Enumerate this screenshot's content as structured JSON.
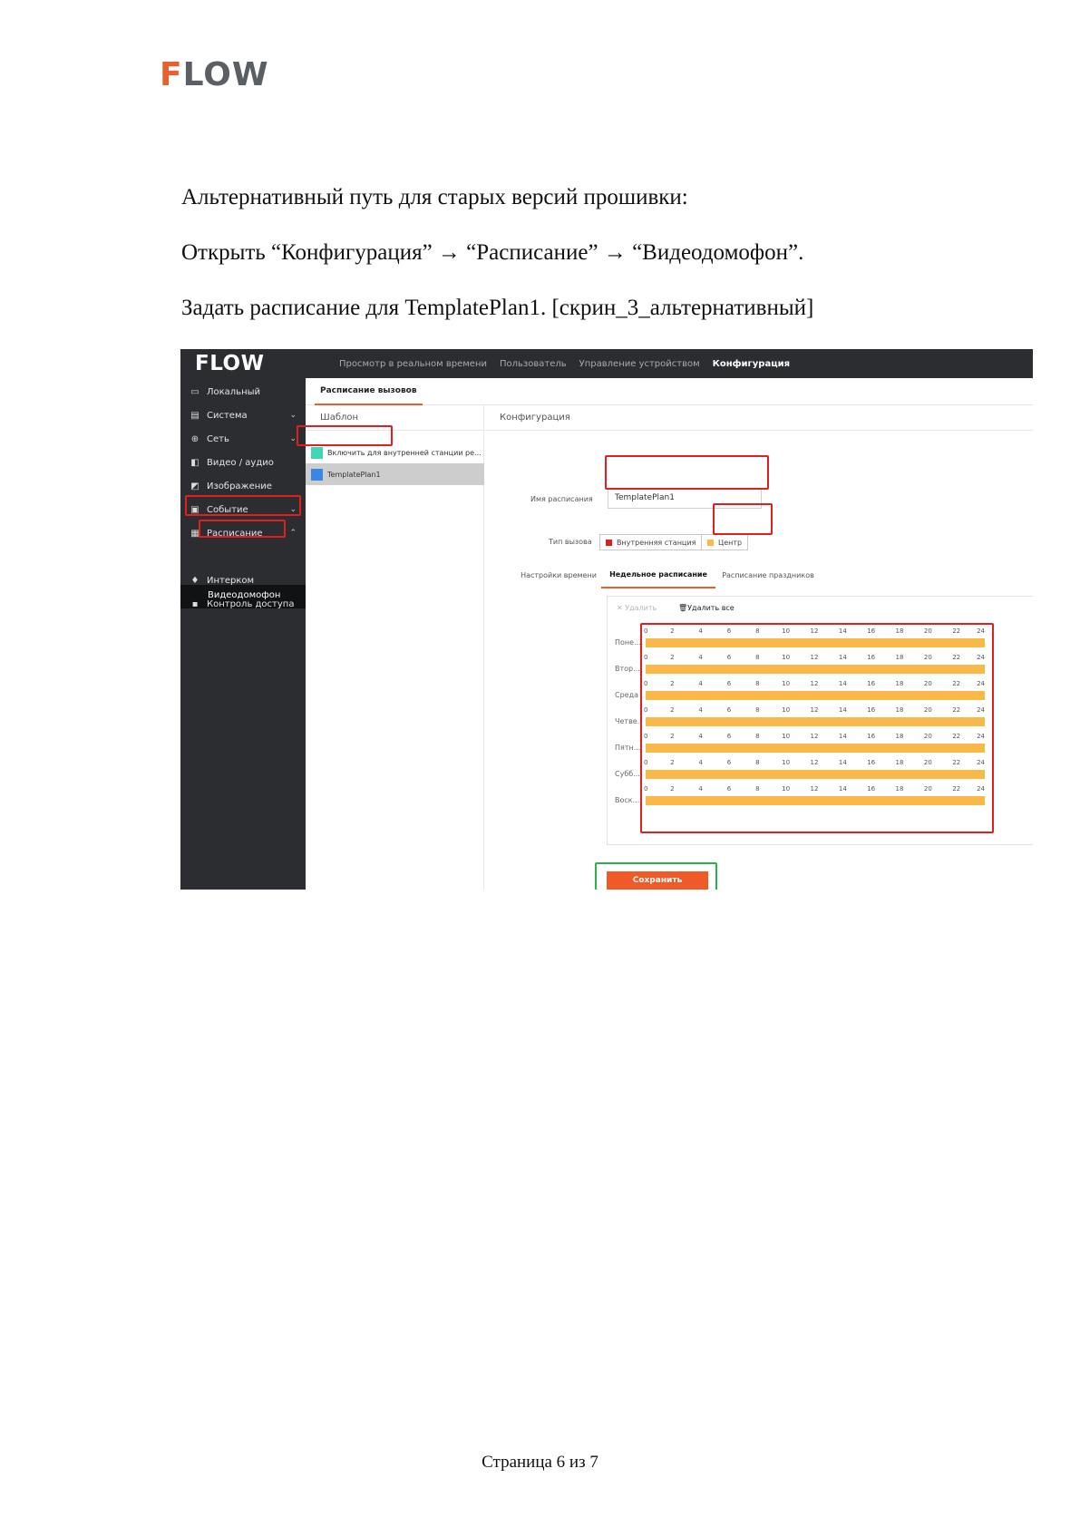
{
  "document": {
    "logo": "FLOW",
    "lines": [
      "Альтернативный путь для старых версий прошивки:",
      "Открыть “Конфигурация” → “Расписание” → “Видеодомофон”.",
      "Задать расписание для TemplatePlan1. [скрин_3_альтернативный]"
    ],
    "footer": "Страница 6 из 7"
  },
  "screenshot": {
    "logo": "FLOW",
    "topnav": [
      "Просмотр в реальном времени",
      "Пользователь",
      "Управление устройством",
      "Конфигурация"
    ],
    "topnav_active": 3,
    "sidebar": [
      {
        "label": "Локальный",
        "icon": "monitor-icon",
        "chevron": ""
      },
      {
        "label": "Система",
        "icon": "system-icon",
        "chevron": "down"
      },
      {
        "label": "Сеть",
        "icon": "globe-icon",
        "chevron": "down"
      },
      {
        "label": "Видео / аудио",
        "icon": "camera-icon",
        "chevron": ""
      },
      {
        "label": "Изображение",
        "icon": "image-icon",
        "chevron": ""
      },
      {
        "label": "Событие",
        "icon": "clipboard-icon",
        "chevron": "down"
      },
      {
        "label": "Расписание",
        "icon": "schedule-icon",
        "chevron": "up"
      },
      {
        "label": "Интерком",
        "icon": "microphone-icon",
        "chevron": ""
      },
      {
        "label": "Контроль доступа",
        "icon": "lock-icon",
        "chevron": ""
      }
    ],
    "sidebar_sub": "Видеодомофон",
    "subtab": "Расписание вызовов",
    "template_header": "Шаблон",
    "templates": [
      {
        "label": "Включить для внутренней станции ре...",
        "color": "#41d6b4",
        "selected": false
      },
      {
        "label": "TemplatePlan1",
        "color": "#3a86e0",
        "selected": true
      }
    ],
    "config_header": "Конфигурация",
    "schedule_name_label": "Имя расписания",
    "schedule_name_value": "TemplatePlan1",
    "call_type_label": "Тип вызова",
    "call_types": [
      {
        "label": "Внутренняя станция",
        "color": "#e02020"
      },
      {
        "label": "Центр",
        "color": "#f9b848"
      }
    ],
    "schedule_tabs": [
      "Настройки времени",
      "Недельное расписание",
      "Расписание праздников"
    ],
    "schedule_tab_active": 1,
    "delete_label": "Удалить",
    "delete_all_label": "Удалить все",
    "days": [
      "Поне...",
      "Втор...",
      "Среда",
      "Четве...",
      "Пятн...",
      "Субб...",
      "Воск..."
    ],
    "hours": [
      "0",
      "2",
      "4",
      "6",
      "8",
      "10",
      "12",
      "14",
      "16",
      "18",
      "20",
      "22",
      "24"
    ],
    "save_label": "Сохранить",
    "colors": {
      "accent": "#e8612c",
      "highlight_red": "#e02020",
      "highlight_green": "#2bb24c",
      "bar": "#f9b848"
    }
  }
}
